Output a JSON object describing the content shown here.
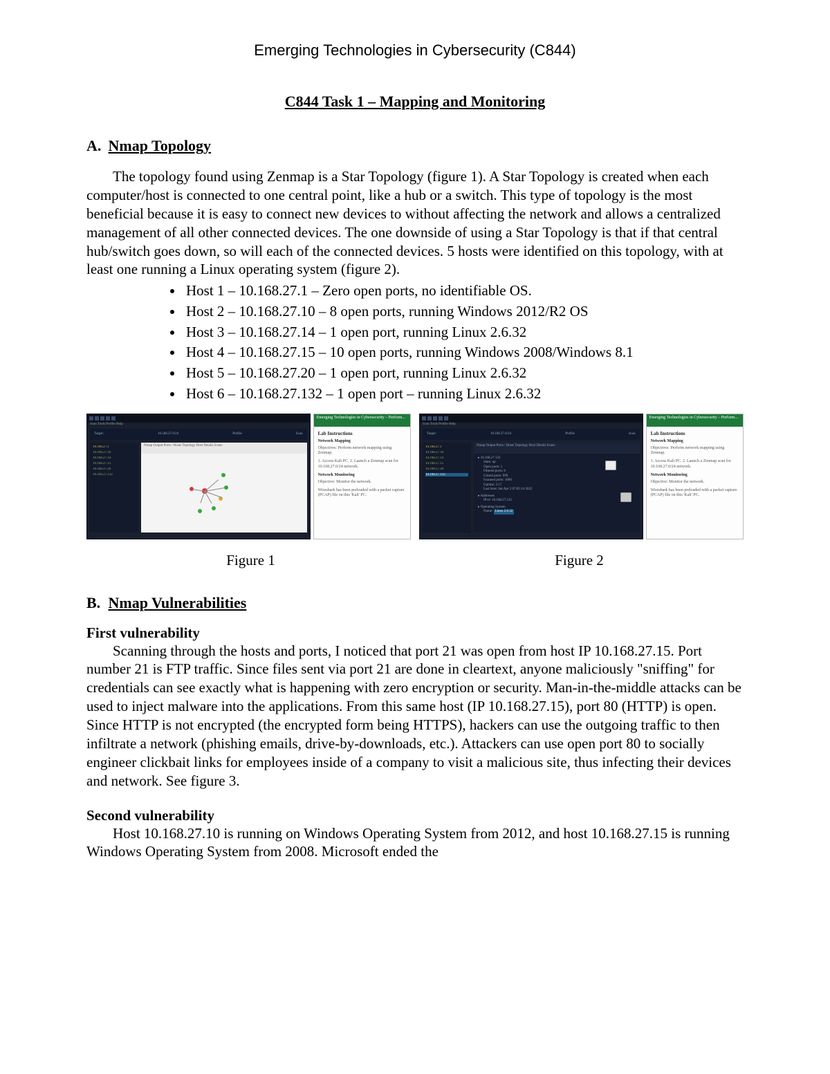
{
  "course_header": "Emerging Technologies in Cybersecurity (C844)",
  "title": "C844 Task 1 – Mapping and Monitoring",
  "sectionA": {
    "label_letter": "A.",
    "label_text": "Nmap Topology",
    "paragraph": "The topology found using Zenmap is a Star Topology (figure 1). A Star Topology is created when each computer/host is connected to one central point, like a hub or a switch. This type of topology is the most beneficial because it is easy to connect new devices to without affecting the network and allows a centralized management of all other connected devices. The one downside of using a Star Topology is that if that central hub/switch goes down, so will each of the connected devices. 5 hosts were identified on this topology, with at least one running a Linux operating system (figure 2).",
    "hosts": [
      "Host 1 – 10.168.27.1 – Zero open ports, no identifiable OS.",
      "Host 2 – 10.168.27.10 – 8 open ports, running Windows 2012/R2 OS",
      "Host 3 – 10.168.27.14 – 1 open port, running Linux 2.6.32",
      "Host 4 – 10.168.27.15 – 10 open ports, running Windows 2008/Windows 8.1",
      "Host 5 – 10.168.27.20 – 1 open port, running Linux 2.6.32",
      "Host 6 – 10.168.27.132 – 1 open port – running Linux 2.6.32"
    ]
  },
  "figures": {
    "fig1_caption": "Figure 1",
    "fig2_caption": "Figure 2",
    "shot1_panel_title": "Lab Instructions",
    "shot1_panel_sub": "Network Mapping",
    "shot1_panel_text1": "Objectives: Perform network mapping using Zenmap.",
    "shot1_panel_text2": "Network Monitoring",
    "shot1_panel_text3": "Objective: Monitor the network.",
    "shot2_panel_title": "Lab Instructions",
    "shot2_panel_sub": "Network Mapping",
    "shot2_panel_text1": "Objectives: Perform network mapping using Zenmap.",
    "shot2_panel_text2": "Network Monitoring",
    "shot2_panel_text3": "Objective: Monitor the network.",
    "green_hdr_text": "Emerging Technologies in Cybersecurity – Perform...",
    "zenmap_target": "10.168.27.0/24",
    "zenmap_profile": "Profile",
    "zenmap_scan": "Scan",
    "side_items": [
      "10.168.27.1",
      "10.168.27.10",
      "10.168.27.14",
      "10.168.27.15",
      "10.168.27.20",
      "10.168.27.132"
    ],
    "tabstrip1": "Nmap Output  Ports / Hosts  Topology  Host Details  Scans",
    "tabstrip2": "Nmap Output  Ports / Hosts  Topology  Host Details  Scans",
    "detail_host": "10.168.27.132",
    "detail_state": "State:  up",
    "detail_open": "Open ports:  1",
    "detail_filtered": "Filtered ports:  0",
    "detail_closed": "Closed ports:  999",
    "detail_scanned": "Scanned ports:  1000",
    "detail_uptime": "Uptime:  2.17",
    "detail_last": "Last boot:  Sat Apr 2 07:05:14 2022",
    "detail_addr_hdr": "Addresses",
    "detail_ipv4": "IPv4:  10.168.27.132",
    "detail_os_hdr": "Operating System",
    "detail_os": "Linux 2.6.32"
  },
  "sectionB": {
    "label_letter": "B.",
    "label_text": "Nmap Vulnerabilities",
    "sub1_title": "First vulnerability",
    "sub1_text": "Scanning through the hosts and ports, I noticed that port 21 was open from host IP 10.168.27.15. Port number 21 is FTP traffic. Since files sent via port 21 are done in cleartext, anyone maliciously \"sniffing\" for credentials can see exactly what is happening with zero encryption or security. Man-in-the-middle attacks can be used to inject malware into the applications. From this same host (IP 10.168.27.15), port 80 (HTTP) is open. Since HTTP is not encrypted (the encrypted form being HTTPS), hackers can use the outgoing traffic to then infiltrate a network (phishing emails, drive-by-downloads, etc.). Attackers can use open port 80 to socially engineer clickbait links for employees inside of a company to visit a malicious site, thus infecting their devices and network. See figure 3.",
    "sub2_title": "Second vulnerability",
    "sub2_text": "Host 10.168.27.10 is running on Windows Operating System from 2012, and host 10.168.27.15 is running Windows Operating System from 2008. Microsoft ended the"
  }
}
